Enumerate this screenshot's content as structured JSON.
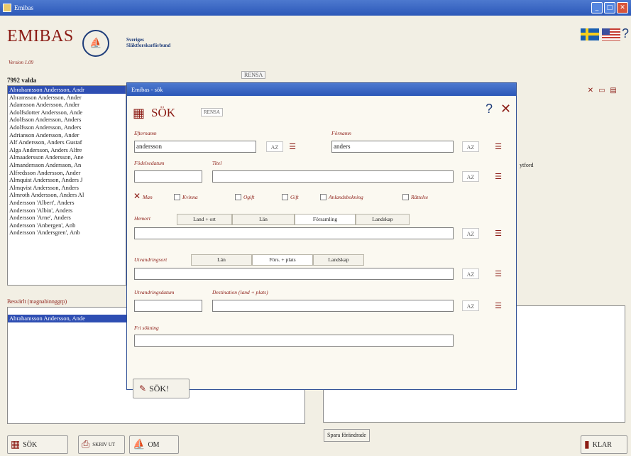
{
  "window": {
    "title": "Emibas"
  },
  "header": {
    "app_name": "EMIBAS",
    "version": "Version 1.09",
    "org": "Sveriges Släktforskarförbund",
    "help": "?"
  },
  "left": {
    "count_label": "7992 valda",
    "results": [
      "Abrahamsson Andersson, Andr",
      "Abramsson Andersson, Ander",
      "Adamsson Andersson, Ander",
      "Adolfsdotter Andersson, Ande",
      "Adolfsson Andersson, Anders",
      "Adolfsson Andersson, Anders",
      "Adrianson Andersson, Ander",
      "Alf Andersson, Anders Gustaf",
      "Alga Andersson, Anders Alfre",
      "Almaadersson Andersson, Ane",
      "Almandersson Andersson, An",
      "Alfredsson Andersson, Ander",
      "Almquist Andersson, Anders J",
      "Almqvist Andersson, Anders",
      "Almroth Andersson, Anders Al",
      "Andersson 'Albert', Anders",
      "Andersson 'Albin', Anders",
      "Andersson 'Arne', Anders",
      "Andersson 'Anbergen', Anb",
      "Andersson 'Andersgren', Anb"
    ],
    "related_label": "Besvärlt (magnabinnggrp)",
    "related_items": [
      "Abrahamsson Andersson, Ande"
    ]
  },
  "background": {
    "toolbar_text": "RENSA",
    "right_fragment": "ytford",
    "save_search": "Spara förändrade"
  },
  "bottom": {
    "sok": "SÖK",
    "skriv_ut": "SKRIV UT",
    "om": "OM",
    "klar": "KLAR"
  },
  "dialog": {
    "title": "Emibas - sök",
    "heading": "SÖK",
    "rensa": "RENSA",
    "help": "?",
    "close": "✕",
    "fields": {
      "efternamn": {
        "label": "Efternamn",
        "value": "andersson"
      },
      "fornamn": {
        "label": "Förnamn",
        "value": "anders"
      },
      "fodelsedatum": {
        "label": "Födelsedatum",
        "value": ""
      },
      "titel": {
        "label": "Titel",
        "value": ""
      },
      "hemort": {
        "label": "Hemort",
        "value": ""
      },
      "utvandringsort": {
        "label": "Utvandringsort",
        "value": ""
      },
      "utvandringsdatum": {
        "label": "Utvandringsdatum",
        "value": ""
      },
      "destination": {
        "label": "Destination (land + plats)",
        "value": ""
      },
      "fri_sokning": {
        "label": "Fri sökning",
        "value": ""
      }
    },
    "az_label": "AZ",
    "list_icon": "list-icon",
    "checkboxes": [
      {
        "label": "Man",
        "checked": true
      },
      {
        "label": "Kvinna",
        "checked": false
      },
      {
        "label": "Ogift",
        "checked": false
      },
      {
        "label": "Gift",
        "checked": false
      },
      {
        "label": "Anlandsbokning",
        "checked": false
      },
      {
        "label": "Rättelse",
        "checked": false
      }
    ],
    "hemort_tabs": [
      "Land + ort",
      "Län",
      "Församling",
      "Landskap"
    ],
    "utvandring_tabs": [
      "Län",
      "Förs. + plats",
      "Landskap"
    ],
    "search_button": "SÖK!"
  },
  "colors": {
    "accent": "#8b1b14",
    "titlebar": "#2c58b8",
    "selection": "#2e4eb3",
    "background": "#f2efe4"
  }
}
